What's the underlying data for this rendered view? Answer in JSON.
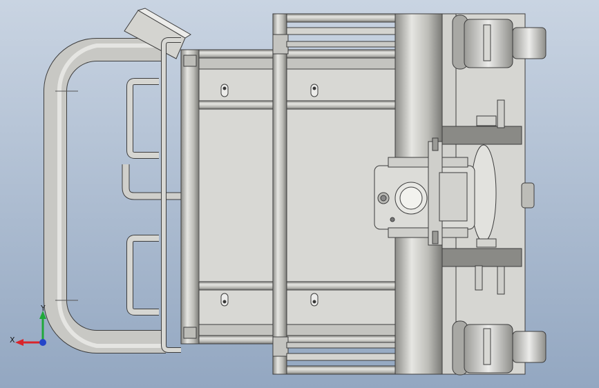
{
  "colors": {
    "background_top": "#c3cfdf",
    "background_bottom": "#8fa4bf",
    "metal_light": "#dcdcd8",
    "metal_mid": "#c8c8c4",
    "metal_dark": "#8a8a86",
    "edge": "#3c3c3c",
    "axis_x": "#d9242a",
    "axis_y": "#1fa83a",
    "axis_z": "#2445c9"
  },
  "triad": {
    "x_label": "X",
    "y_label": "Y",
    "icon": "coordinate-triad-icon"
  }
}
